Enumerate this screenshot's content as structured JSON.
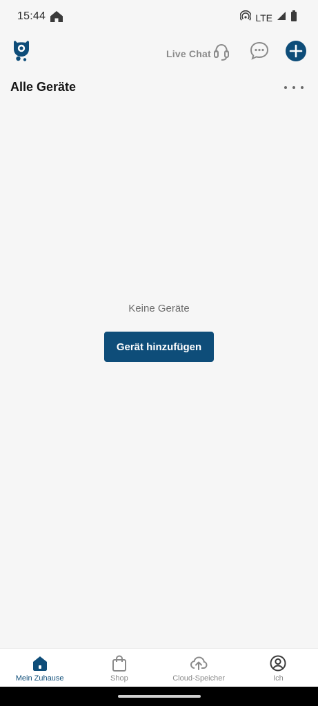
{
  "status_bar": {
    "time": "15:44",
    "network": "LTE",
    "icons": [
      "home-icon",
      "hotspot-icon",
      "signal-icon",
      "battery-icon"
    ]
  },
  "header": {
    "live_chat_label": "Live Chat",
    "icons": [
      "app-logo",
      "headset-icon",
      "chat-bubble-icon",
      "plus-icon"
    ]
  },
  "page": {
    "title": "Alle Geräte",
    "empty_text": "Keine Geräte",
    "add_device_label": "Gerät hinzufügen"
  },
  "bottom_nav": {
    "items": [
      {
        "label": "Mein Zuhause",
        "icon": "home-icon",
        "active": true
      },
      {
        "label": "Shop",
        "icon": "shopping-bag-icon",
        "active": false
      },
      {
        "label": "Cloud-Speicher",
        "icon": "cloud-upload-icon",
        "active": false
      },
      {
        "label": "Ich",
        "icon": "user-circle-icon",
        "active": false
      }
    ]
  },
  "colors": {
    "accent": "#0e4d79",
    "background": "#f6f6f6",
    "inactive": "#8a8a8a"
  }
}
